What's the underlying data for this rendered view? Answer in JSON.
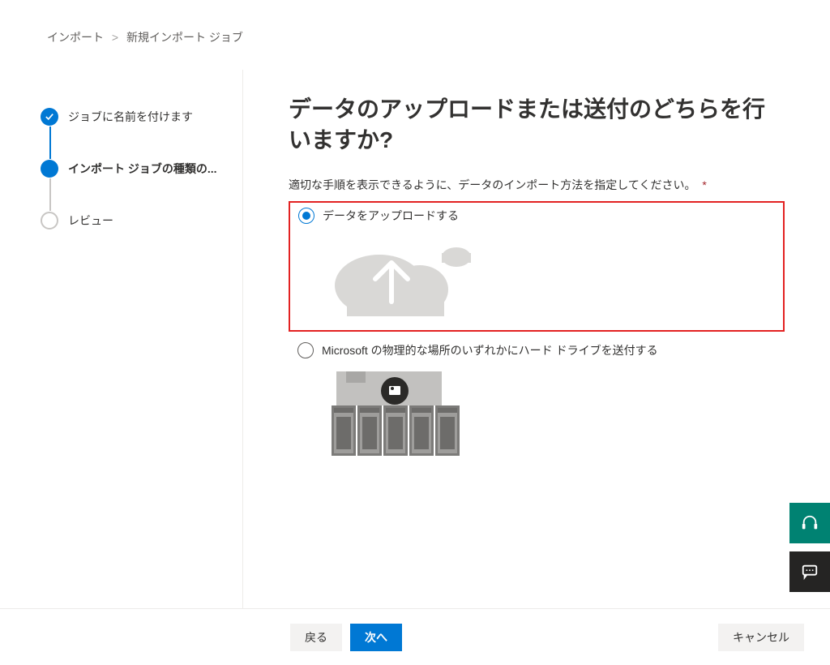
{
  "breadcrumb": {
    "root": "インポート",
    "current": "新規インポート ジョブ"
  },
  "steps": [
    {
      "label": "ジョブに名前を付けます",
      "state": "done"
    },
    {
      "label": "インポート ジョブの種類の...",
      "state": "current"
    },
    {
      "label": "レビュー",
      "state": "upcoming"
    }
  ],
  "page": {
    "title": "データのアップロードまたは送付のどちらを行いますか?",
    "instruction": "適切な手順を表示できるように、データのインポート方法を指定してください。",
    "required_mark": "*"
  },
  "options": [
    {
      "label": "データをアップロードする",
      "selected": true,
      "highlighted": true,
      "icon": "cloud-upload"
    },
    {
      "label": "Microsoft の物理的な場所のいずれかにハード ドライブを送付する",
      "selected": false,
      "highlighted": false,
      "icon": "datacenter"
    }
  ],
  "footer": {
    "back": "戻る",
    "next": "次へ",
    "cancel": "キャンセル"
  }
}
